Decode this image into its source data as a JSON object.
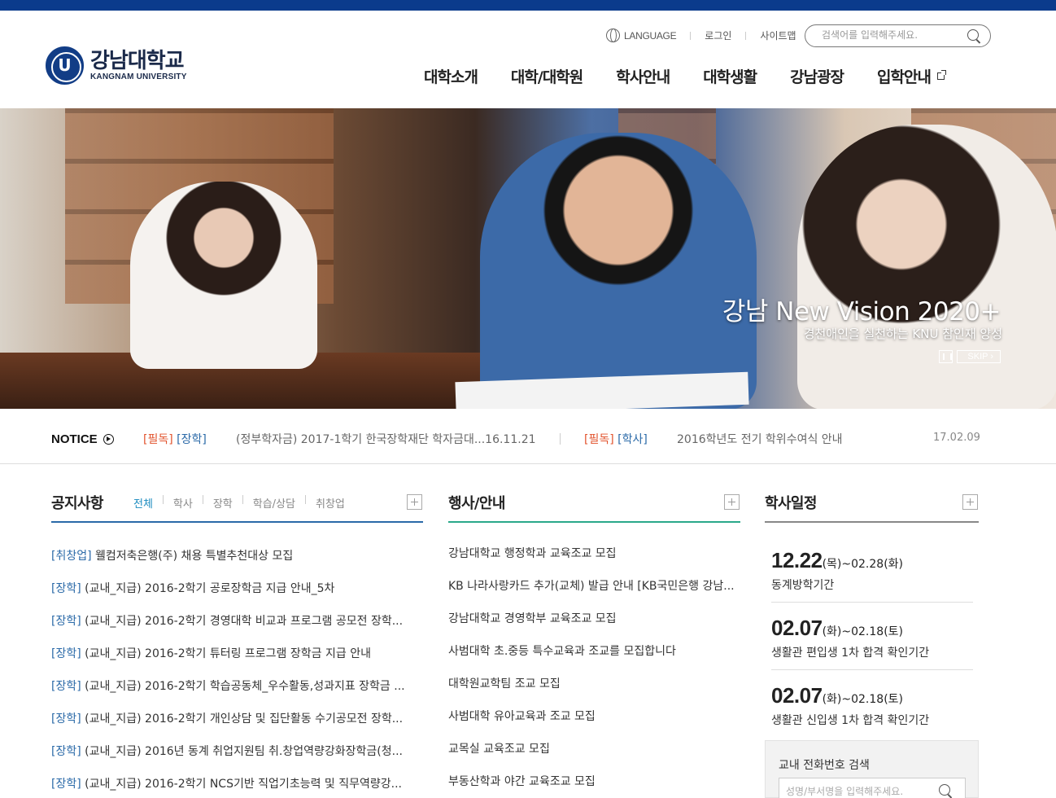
{
  "header": {
    "logo_ko": "강남대학교",
    "logo_en": "KANGNAM UNIVERSITY",
    "util": {
      "language": "LANGUAGE",
      "login": "로그인",
      "sitemap": "사이트맵"
    },
    "search_placeholder": "검색어를 입력해주세요.",
    "nav": [
      "대학소개",
      "대학/대학원",
      "학사안내",
      "대학생활",
      "강남광장",
      "입학안내"
    ]
  },
  "hero": {
    "title": "강남 New Vision 2020+",
    "subtitle": "경천애인을 실천하는 KNU 참인재 양성",
    "skip_label": "SKIP"
  },
  "notice": {
    "label": "NOTICE",
    "items": [
      {
        "tag1": "[필독]",
        "tag2": "[장학]",
        "text": "(정부학자금) 2017-1학기 한국장학재단 학자금대...16.11.21"
      },
      {
        "tag1": "[필독]",
        "tag2": "[학사]",
        "text": "2016학년도 전기 학위수여식 안내",
        "date": "17.02.09"
      }
    ]
  },
  "announcements": {
    "title": "공지사항",
    "tabs": [
      "전체",
      "학사",
      "장학",
      "학습/상담",
      "취창업"
    ],
    "items": [
      {
        "cat": "[취창업]",
        "text": " 웰컴저축은행(주) 채용 특별추천대상 모집"
      },
      {
        "cat": "[장학]",
        "text": " (교내_지급) 2016-2학기 공로장학금 지급 안내_5차"
      },
      {
        "cat": "[장학]",
        "text": " (교내_지급) 2016-2학기 경영대학 비교과 프로그램 공모전 장학..."
      },
      {
        "cat": "[장학]",
        "text": " (교내_지급) 2016-2학기 튜터링 프로그램 장학금 지급 안내"
      },
      {
        "cat": "[장학]",
        "text": " (교내_지급) 2016-2학기 학습공동체_우수활동,성과지표 장학금 ..."
      },
      {
        "cat": "[장학]",
        "text": " (교내_지급) 2016-2학기 개인상담 및 집단활동 수기공모전 장학..."
      },
      {
        "cat": "[장학]",
        "text": " (교내_지급) 2016년 동계 취업지원팀 취.창업역량강화장학금(청..."
      },
      {
        "cat": "[장학]",
        "text": " (교내_지급) 2016-2학기 NCS기반 직업기초능력 및 직무역량강..."
      }
    ]
  },
  "events": {
    "title": "행사/안내",
    "items": [
      "강남대학교 행정학과 교육조교 모집",
      "KB 나라사랑카드 추가(교체) 발급 안내 [KB국민은행 강남...",
      "강남대학교 경영학부 교육조교 모집",
      "사범대학 초.중등 특수교육과 조교를 모집합니다",
      "대학원교학팀 조교 모집",
      "사범대학 유아교육과 조교 모집",
      "교목실 교육조교 모집",
      "부동산학과 야간 교육조교 모집"
    ]
  },
  "schedule": {
    "title": "학사일정",
    "items": [
      {
        "day": "12.22",
        "range": "(목)~02.28(화)",
        "desc": "동계방학기간"
      },
      {
        "day": "02.07",
        "range": "(화)~02.18(토)",
        "desc": "생활관 편입생 1차 합격 확인기간"
      },
      {
        "day": "02.07",
        "range": "(화)~02.18(토)",
        "desc": "생활관 신입생 1차 합격 확인기간"
      }
    ]
  },
  "phone_search": {
    "title": "교내 전화번호 검색",
    "placeholder": "성명/부서명을 입력해주세요."
  },
  "colors": {
    "topbar": "#0b3b8c",
    "accent_blue": "#2b6aa8",
    "accent_red": "#e2542e",
    "events_underline": "#2aa88a"
  }
}
